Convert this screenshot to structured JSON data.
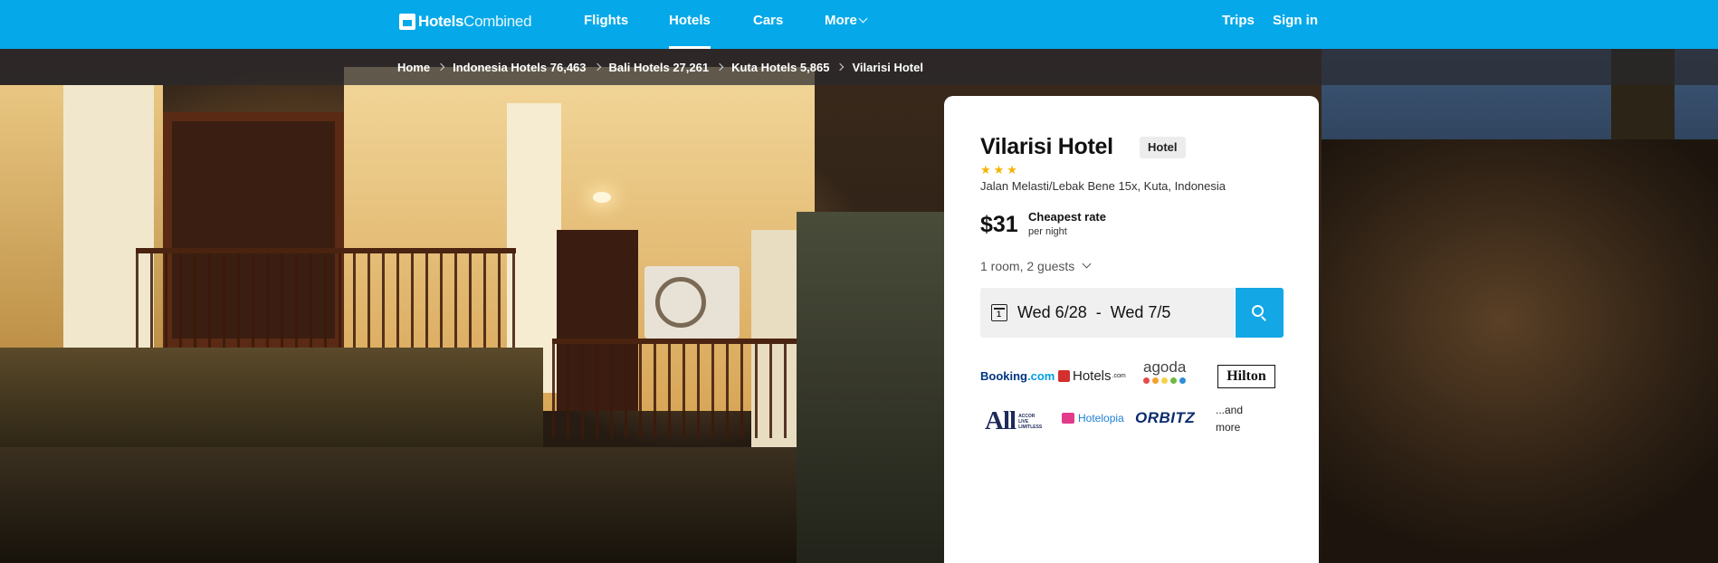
{
  "nav": {
    "logo_text_bold": "Hotels",
    "logo_text_rest": "Combined",
    "links": [
      {
        "label": "Flights",
        "active": false
      },
      {
        "label": "Hotels",
        "active": true
      },
      {
        "label": "Cars",
        "active": false
      },
      {
        "label": "More",
        "active": false
      }
    ],
    "trips_label": "Trips",
    "signin_label": "Sign in"
  },
  "breadcrumb": {
    "items": [
      {
        "label": "Home"
      },
      {
        "label": "Indonesia Hotels 76,463"
      },
      {
        "label": "Bali Hotels 27,261"
      },
      {
        "label": "Kuta Hotels 5,865"
      }
    ],
    "current": "Vilarisi Hotel"
  },
  "hotel": {
    "name": "Vilarisi Hotel",
    "type": "Hotel",
    "stars": "★★★",
    "star_count": 3,
    "address": "Jalan Melasti/Lebak Bene 15x, Kuta, Indonesia"
  },
  "price": {
    "amount": "$31",
    "label": "Cheapest rate",
    "sub": "per night"
  },
  "search": {
    "guests": "1 room, 2 guests",
    "calendar_day": "1",
    "dates": "Wed 6/28  -  Wed 7/5",
    "button_icon": "search-icon"
  },
  "partners": {
    "booking": "Booking",
    "booking_dot": ".com",
    "hotels": "Hotels",
    "hotels_suffix": ".com",
    "agoda": "agoda",
    "hilton": "Hilton",
    "all_logo": "All",
    "all_tagline": "ACCOR LIVE LIMITLESS",
    "hotelopia": "Hotelopia",
    "orbitz": "ORBITZ",
    "more": "...and more"
  },
  "colors": {
    "brand": "#05a9e9",
    "search_button": "#13a7e6",
    "star": "#f5b301"
  }
}
